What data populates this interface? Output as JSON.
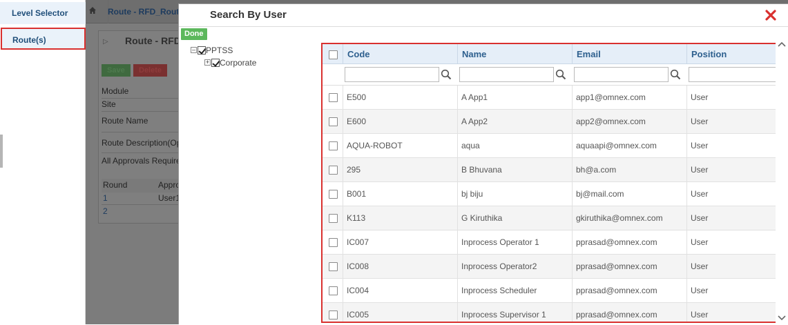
{
  "leftnav": {
    "level_selector": "Level Selector",
    "routes": "Route(s)"
  },
  "background": {
    "breadcrumb": "Route - RFD_Route",
    "panel_title": "Route - RFD",
    "save_label": "Save",
    "delete_label": "Delete",
    "fields": [
      "Module",
      "Site",
      "Route Name",
      "Route Description(Op",
      "All Approvals Require"
    ],
    "round_header": "Round",
    "approver_header": "Appro",
    "rounds": [
      {
        "round": "1",
        "approver": "User1"
      },
      {
        "round": "2",
        "approver": ""
      }
    ]
  },
  "modal": {
    "title": "Search By User",
    "done_label": "Done",
    "tree": {
      "root": "PPTSS",
      "child": "Corporate"
    },
    "columns": [
      "Code",
      "Name",
      "Email",
      "Position"
    ],
    "rows": [
      {
        "code": "E500",
        "name": "A App1",
        "email": "app1@omnex.com",
        "position": "User"
      },
      {
        "code": "E600",
        "name": "A App2",
        "email": "app2@omnex.com",
        "position": "User"
      },
      {
        "code": "AQUA-ROBOT",
        "name": "aqua",
        "email": "aquaapi@omnex.com",
        "position": "User"
      },
      {
        "code": "295",
        "name": "B Bhuvana",
        "email": "bh@a.com",
        "position": "User"
      },
      {
        "code": "B001",
        "name": "bj biju",
        "email": "bj@mail.com",
        "position": "User"
      },
      {
        "code": "K113",
        "name": "G Kiruthika",
        "email": "gkiruthika@omnex.com",
        "position": "User"
      },
      {
        "code": "IC007",
        "name": "Inprocess Operator 1",
        "email": "pprasad@omnex.com",
        "position": "User"
      },
      {
        "code": "IC008",
        "name": "Inprocess Operator2",
        "email": "pprasad@omnex.com",
        "position": "User"
      },
      {
        "code": "IC004",
        "name": "Inprocess Scheduler",
        "email": "pprasad@omnex.com",
        "position": "User"
      },
      {
        "code": "IC005",
        "name": "Inprocess Supervisor 1",
        "email": "pprasad@omnex.com",
        "position": "User"
      }
    ]
  },
  "colors": {
    "accent_red": "#d9302e",
    "header_blue": "#2d5f8e",
    "done_green": "#5cb85c"
  }
}
